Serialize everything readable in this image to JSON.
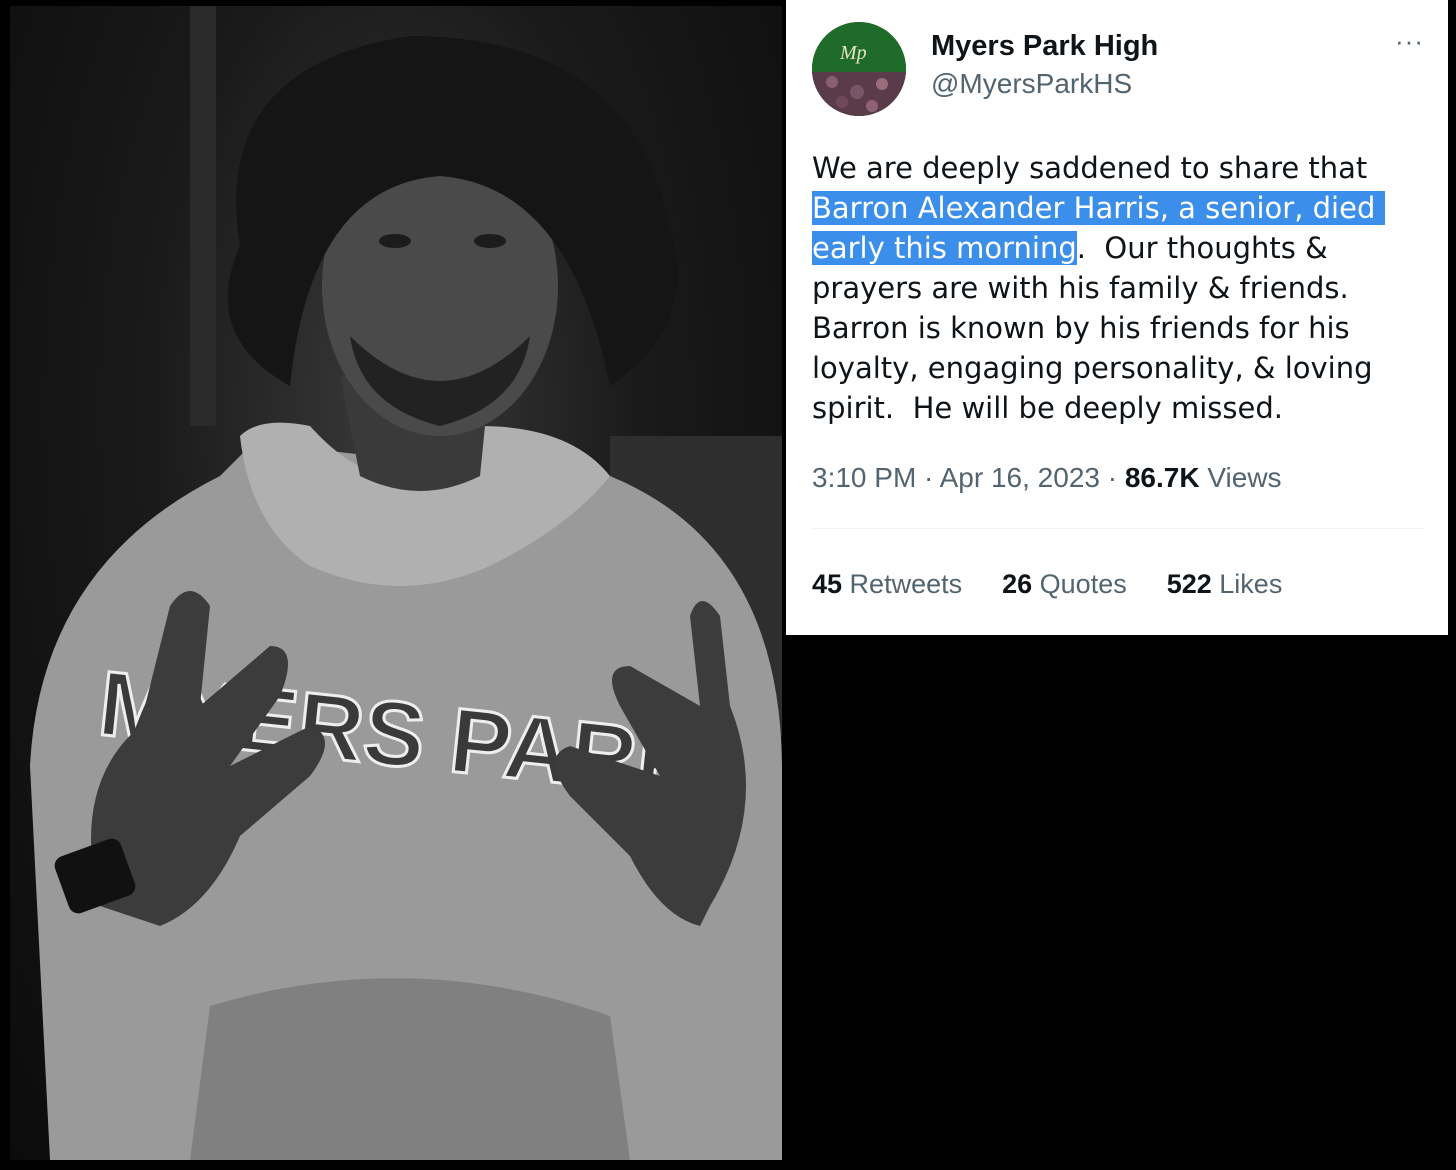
{
  "tweet": {
    "display_name": "Myers Park High",
    "handle": "@MyersParkHS",
    "avatar_text": "Mp",
    "more_label": "···",
    "text_before": "We are deeply saddened to share that ",
    "text_highlight": "Barron Alexander Harris, a senior, died early this morning",
    "text_after": ".  Our thoughts & prayers are with his family & friends.  Barron is known by his friends for his loyalty, engaging personality, & loving spirit.  He will be deeply missed.",
    "time": "3:10 PM",
    "sep": " · ",
    "date": "Apr 16, 2023",
    "views_count": "86.7K",
    "views_label": " Views",
    "retweets_count": "45",
    "retweets_label": " Retweets",
    "quotes_count": "26",
    "quotes_label": " Quotes",
    "likes_count": "522",
    "likes_label": " Likes"
  },
  "photo": {
    "sweatshirt_text": "MYERS PARK"
  },
  "colors": {
    "highlight": "#3b8eea",
    "secondary_text": "#536471",
    "primary_text": "#0f1419"
  }
}
